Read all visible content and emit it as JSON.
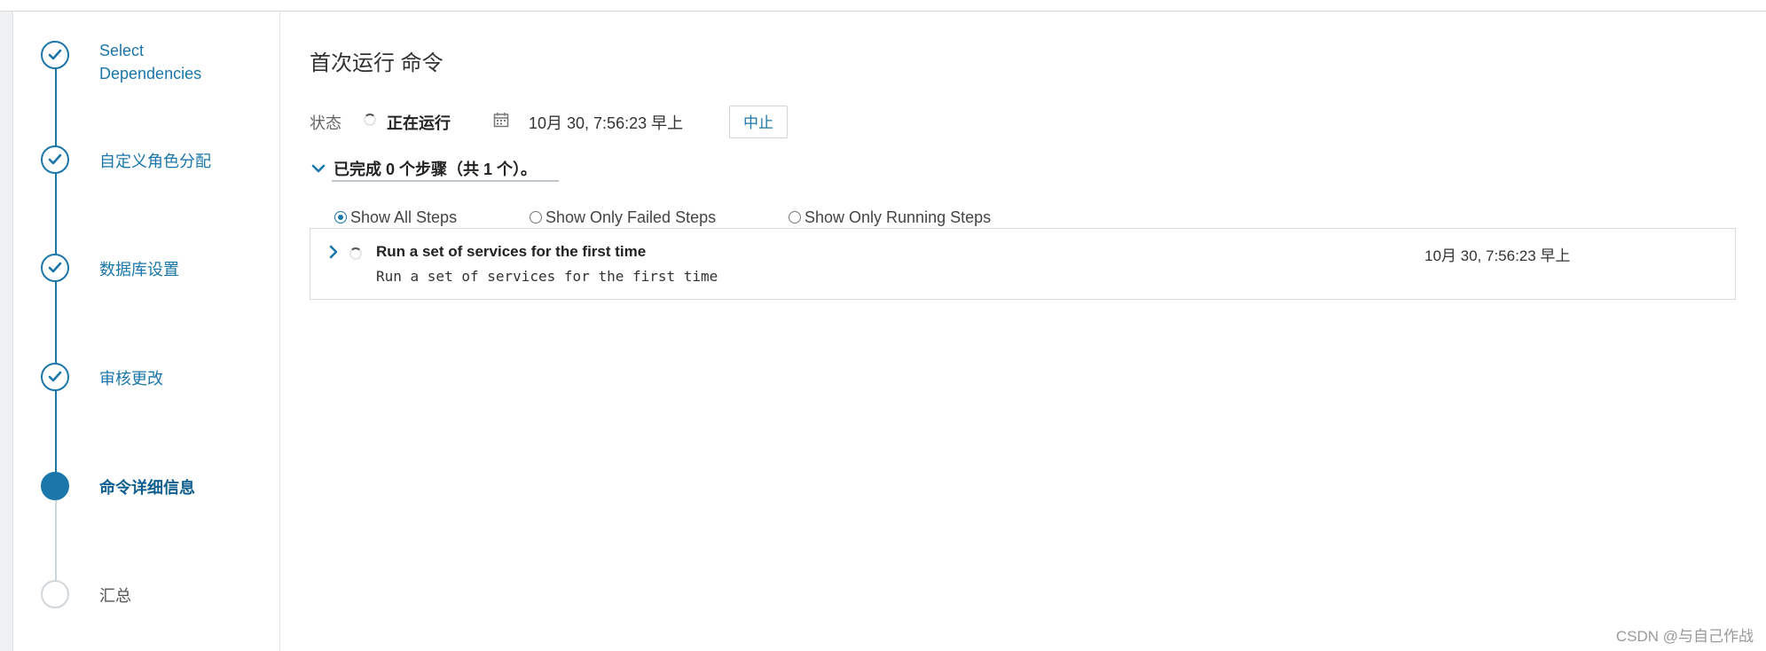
{
  "wizard": {
    "steps": [
      {
        "label": "Select\nDependencies",
        "state": "done"
      },
      {
        "label": "自定义角色分配",
        "state": "done"
      },
      {
        "label": "数据库设置",
        "state": "done"
      },
      {
        "label": "审核更改",
        "state": "done"
      },
      {
        "label": "命令详细信息",
        "state": "active"
      },
      {
        "label": "汇总",
        "state": "todo"
      }
    ]
  },
  "main": {
    "title": "首次运行 命令",
    "status_label": "状态",
    "status_value": "正在运行",
    "status_time": "10月 30, 7:56:23 早上",
    "abort_label": "中止",
    "steps_summary": "已完成 0 个步骤（共 1 个）。",
    "filters": [
      {
        "label": "Show All Steps",
        "checked": true
      },
      {
        "label": "Show Only Failed Steps",
        "checked": false
      },
      {
        "label": "Show Only Running Steps",
        "checked": false
      }
    ],
    "rows": [
      {
        "title": "Run a set of services for the first time",
        "description": "Run a set of services for the first time",
        "time": "10月 30, 7:56:23 早上"
      }
    ]
  },
  "watermark": "CSDN @与自己作战",
  "colors": {
    "accent": "#1b76aa",
    "border": "#d7dcdf"
  },
  "icons": [
    "check-icon",
    "spinner-icon",
    "calendar-icon",
    "chevron-down-icon",
    "chevron-right-icon"
  ]
}
